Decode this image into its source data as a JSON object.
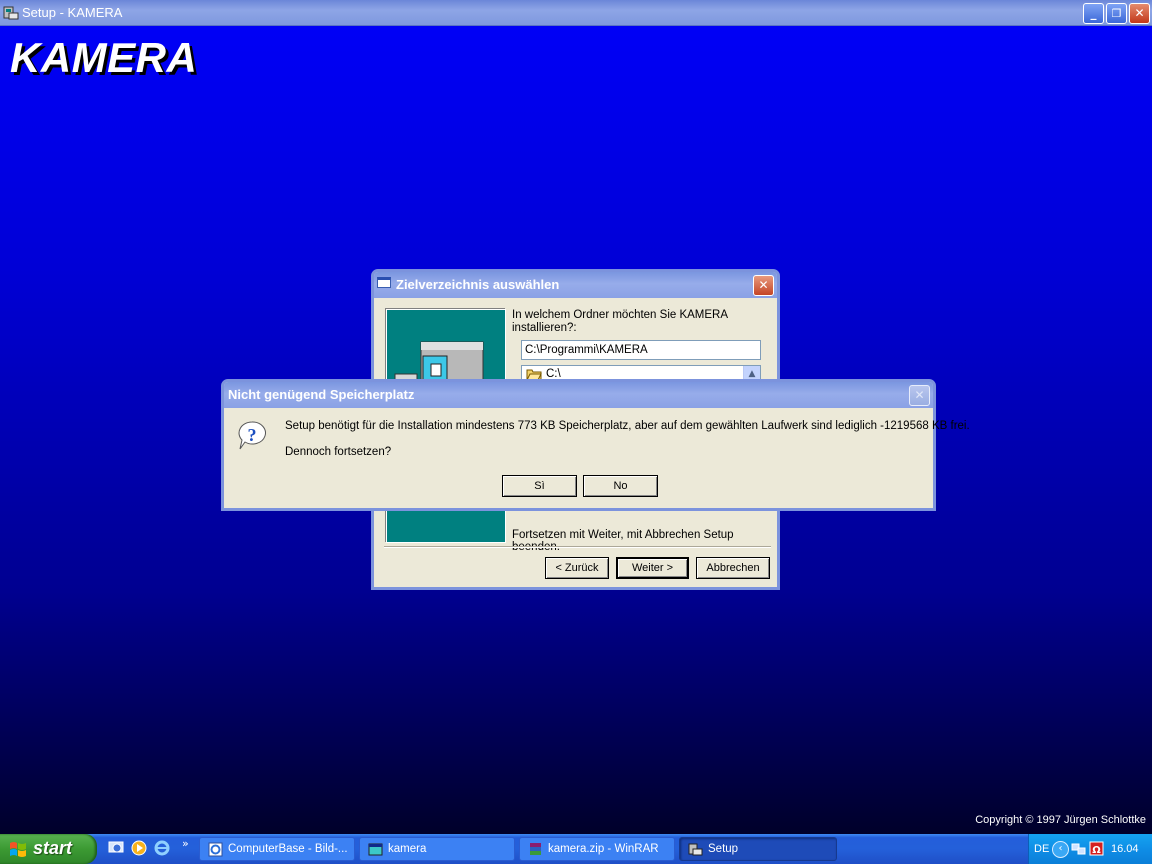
{
  "main_window": {
    "title": "Setup - KAMERA",
    "app_icon": "setup-icon",
    "brand": "KAMERA",
    "copyright": "Copyright © 1997 Jürgen Schlottke",
    "controls": {
      "minimize": "_",
      "restore": "❐",
      "close": "✕"
    }
  },
  "back_dialog": {
    "title": "Zielverzeichnis auswählen",
    "prompt": "In welchem Ordner möchten Sie KAMERA installieren?:",
    "path_value": "C:\\Programmi\\KAMERA",
    "folder_item": "C:\\",
    "hint": "Fortsetzen mit Weiter, mit Abbrechen Setup beenden.",
    "buttons": {
      "back": "< Zurück",
      "next": "Weiter >",
      "cancel": "Abbrechen"
    }
  },
  "message_box": {
    "title": "Nicht genügend Speicherplatz",
    "message": "Setup benötigt für die Installation mindestens 773 KB Speicherplatz, aber auf dem gewählten Laufwerk sind lediglich -1219568 KB frei.",
    "question": "Dennoch fortsetzen?",
    "icon": "question-icon",
    "buttons": {
      "yes": "Sì",
      "no": "No"
    }
  },
  "taskbar": {
    "start_label": "start",
    "quick_launch": [
      "desktop-icon",
      "media-player-icon",
      "internet-explorer-icon"
    ],
    "more": "»",
    "tasks": [
      {
        "label": "ComputerBase - Bild-...",
        "icon": "browser-icon"
      },
      {
        "label": "kamera",
        "icon": "folder-window-icon"
      },
      {
        "label": "kamera.zip - WinRAR",
        "icon": "winrar-icon"
      },
      {
        "label": "Setup",
        "icon": "setup-icon",
        "active": true
      }
    ],
    "tray": {
      "language": "DE",
      "expand": "‹",
      "clock": "16.04"
    }
  },
  "colors": {
    "desktop_top": "#0000f6",
    "desktop_bottom": "#00002a",
    "dialog_face": "#ece9d8",
    "panel_teal": "#008080"
  }
}
